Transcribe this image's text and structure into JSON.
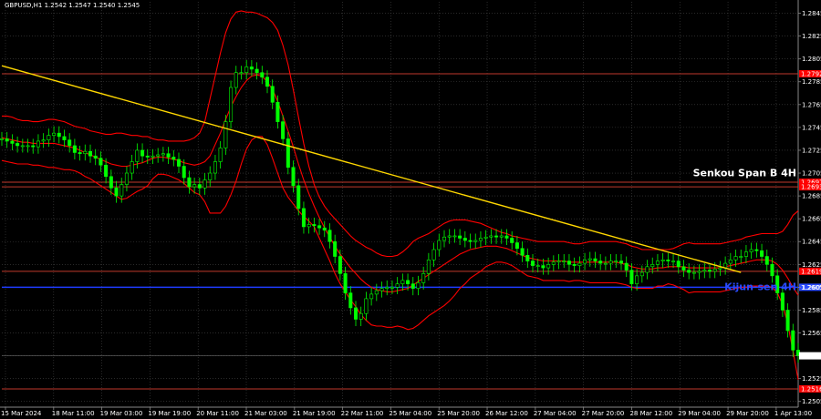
{
  "chart_data": {
    "type": "candlestick",
    "title": "GBPUSD,H1  1.2542 1.2547 1.2540 1.2545",
    "ylim": [
      1.25,
      1.2855
    ],
    "grid": true,
    "colors": {
      "background": "#000000",
      "candle_up": "#00ff00",
      "candle_down": "#00ff00",
      "ichimoku_lines": "#ff0000",
      "trendline": "#ffd700",
      "level_red": "#c0392b",
      "level_blue": "#1e3cff",
      "label_red": "#ff0000",
      "label_blue": "#2a4bff",
      "label_gray": "#777777"
    },
    "yticks": [
      "1.2845",
      "1.2825",
      "1.2805",
      "1.2785",
      "1.2765",
      "1.2745",
      "1.2725",
      "1.2705",
      "1.2685",
      "1.2665",
      "1.2645",
      "1.2625",
      "1.2605",
      "1.2585",
      "1.2565",
      "1.2545",
      "1.2525",
      "1.2505"
    ],
    "xticks": [
      "15 Mar 2024",
      "18 Mar 11:00",
      "19 Mar 03:00",
      "19 Mar 19:00",
      "20 Mar 11:00",
      "21 Mar 03:00",
      "21 Mar 19:00",
      "22 Mar 11:00",
      "25 Mar 04:00",
      "25 Mar 20:00",
      "26 Mar 12:00",
      "27 Mar 04:00",
      "27 Mar 20:00",
      "28 Mar 12:00",
      "29 Mar 04:00",
      "29 Mar 20:00",
      "1 Apr 13:00"
    ],
    "levels": [
      {
        "value": 1.2792,
        "label": "1.2792",
        "color": "#c0392b"
      },
      {
        "value": 1.2697,
        "label": "1.2697",
        "color": "#c0392b"
      },
      {
        "value": 1.2693,
        "label": "1.2693",
        "color": "#c0392b"
      },
      {
        "value": 1.2619,
        "label": "1.2619",
        "color": "#c0392b"
      },
      {
        "value": 1.2605,
        "label": "1.2605",
        "color": "#1e3cff"
      },
      {
        "value": 1.2516,
        "label": "1.2516",
        "color": "#c0392b"
      }
    ],
    "current_price": {
      "value": 1.2545,
      "label": "1.2545"
    },
    "annotations": [
      {
        "text": "Senkou Span B 4H",
        "price": 1.27,
        "color": "#ffffff"
      },
      {
        "text": "Kijun-sen 4H",
        "price": 1.26,
        "color": "#2a4bff"
      }
    ],
    "trendline": {
      "start": [
        0,
        1.2799
      ],
      "end": [
        142,
        1.2618
      ]
    },
    "close_series": [
      1.2735,
      1.2733,
      1.2731,
      1.2729,
      1.2729,
      1.2729,
      1.2728,
      1.2733,
      1.2734,
      1.2738,
      1.274,
      1.2737,
      1.2734,
      1.2729,
      1.2723,
      1.2722,
      1.2724,
      1.272,
      1.2718,
      1.2712,
      1.2702,
      1.2692,
      1.2685,
      1.2695,
      1.2705,
      1.2715,
      1.2725,
      1.272,
      1.2719,
      1.272,
      1.2721,
      1.2722,
      1.2719,
      1.2717,
      1.2711,
      1.2701,
      1.2693,
      1.2695,
      1.2692,
      1.2699,
      1.2705,
      1.2715,
      1.2727,
      1.275,
      1.278,
      1.2793,
      1.2793,
      1.2798,
      1.2796,
      1.2793,
      1.2789,
      1.2781,
      1.2767,
      1.275,
      1.2735,
      1.271,
      1.2694,
      1.2674,
      1.2658,
      1.266,
      1.2659,
      1.2657,
      1.2655,
      1.2645,
      1.2632,
      1.2617,
      1.26,
      1.2587,
      1.2577,
      1.2582,
      1.2595,
      1.2599,
      1.2602,
      1.2604,
      1.2605,
      1.2605,
      1.2608,
      1.2611,
      1.2608,
      1.2604,
      1.2609,
      1.2617,
      1.2629,
      1.2638,
      1.2646,
      1.2649,
      1.265,
      1.265,
      1.2648,
      1.2646,
      1.2645,
      1.2646,
      1.2648,
      1.2649,
      1.265,
      1.2649,
      1.265,
      1.2648,
      1.2644,
      1.2639,
      1.2633,
      1.2628,
      1.2624,
      1.2624,
      1.2622,
      1.2625,
      1.2627,
      1.2628,
      1.2628,
      1.2625,
      1.2624,
      1.2626,
      1.2629,
      1.263,
      1.2628,
      1.2626,
      1.2626,
      1.2628,
      1.2628,
      1.2626,
      1.262,
      1.2608,
      1.2615,
      1.2618,
      1.2623,
      1.2625,
      1.2628,
      1.2629,
      1.2628,
      1.2628,
      1.2623,
      1.262,
      1.2618,
      1.2618,
      1.2619,
      1.262,
      1.2619,
      1.2621,
      1.2622,
      1.2626,
      1.2629,
      1.2632,
      1.2632,
      1.2636,
      1.2638,
      1.2637,
      1.2632,
      1.2625,
      1.2615,
      1.26,
      1.2585,
      1.2567,
      1.255,
      1.2545
    ],
    "bollinger_upper": [
      1.2755,
      1.2755,
      1.2754,
      1.2752,
      1.2751,
      1.2751,
      1.275,
      1.275,
      1.2751,
      1.2752,
      1.2752,
      1.2751,
      1.275,
      1.2748,
      1.2746,
      1.2745,
      1.2744,
      1.2742,
      1.2741,
      1.274,
      1.2739,
      1.2739,
      1.274,
      1.274,
      1.2739,
      1.2738,
      1.2738,
      1.2737,
      1.2737,
      1.2735,
      1.2734,
      1.2734,
      1.2733,
      1.2733,
      1.2733,
      1.2733,
      1.2734,
      1.2736,
      1.274,
      1.275,
      1.277,
      1.279,
      1.281,
      1.2828,
      1.284,
      1.2846,
      1.2847,
      1.2846,
      1.2846,
      1.2845,
      1.2843,
      1.2841,
      1.2837,
      1.283,
      1.2817,
      1.28,
      1.2778,
      1.2754,
      1.2731,
      1.2711,
      1.2695,
      1.2684,
      1.2676,
      1.267,
      1.2665,
      1.266,
      1.2655,
      1.265,
      1.2646,
      1.2643,
      1.264,
      1.2638,
      1.2635,
      1.2633,
      1.2632,
      1.2632,
      1.2633,
      1.2636,
      1.264,
      1.2645,
      1.2648,
      1.265,
      1.2652,
      1.2655,
      1.2658,
      1.2661,
      1.2663,
      1.2664,
      1.2664,
      1.2664,
      1.2663,
      1.2662,
      1.2661,
      1.2659,
      1.2657,
      1.2655,
      1.2653,
      1.2652,
      1.265,
      1.2649,
      1.2648,
      1.2647,
      1.2646,
      1.2645,
      1.2645,
      1.2645,
      1.2645,
      1.2645,
      1.2645,
      1.2644,
      1.2643,
      1.2643,
      1.2644,
      1.2645,
      1.2645,
      1.2645,
      1.2645,
      1.2645,
      1.2645,
      1.2644,
      1.2643,
      1.2641,
      1.264,
      1.2638,
      1.2638,
      1.2638,
      1.2638,
      1.2638,
      1.2638,
      1.2639,
      1.2641,
      1.2643,
      1.2644,
      1.2643,
      1.2643,
      1.2643,
      1.2643,
      1.2643,
      1.2643,
      1.2644,
      1.2645,
      1.2646,
      1.2647,
      1.2649,
      1.265,
      1.2651,
      1.2652,
      1.2652,
      1.2652,
      1.2652,
      1.2654,
      1.266,
      1.2668,
      1.2672
    ],
    "bollinger_middle": [
      1.2736,
      1.2735,
      1.2734,
      1.2733,
      1.2732,
      1.2732,
      1.2731,
      1.2731,
      1.2731,
      1.2731,
      1.2731,
      1.273,
      1.2729,
      1.2728,
      1.2727,
      1.2725,
      1.2723,
      1.2721,
      1.2719,
      1.2717,
      1.2715,
      1.2713,
      1.2712,
      1.2711,
      1.2711,
      1.2712,
      1.2713,
      1.2714,
      1.2716,
      1.2718,
      1.2719,
      1.2719,
      1.2718,
      1.2717,
      1.2716,
      1.2714,
      1.2713,
      1.2712,
      1.2713,
      1.2715,
      1.272,
      1.273,
      1.274,
      1.2752,
      1.2763,
      1.2772,
      1.278,
      1.2786,
      1.279,
      1.2791,
      1.279,
      1.2785,
      1.2778,
      1.2768,
      1.2755,
      1.2742,
      1.2728,
      1.2713,
      1.2699,
      1.2687,
      1.2676,
      1.2666,
      1.2657,
      1.2649,
      1.2641,
      1.2634,
      1.2628,
      1.2622,
      1.2617,
      1.2612,
      1.2608,
      1.2605,
      1.2603,
      1.2602,
      1.2601,
      1.2601,
      1.2602,
      1.2603,
      1.2604,
      1.2607,
      1.261,
      1.2613,
      1.2616,
      1.2619,
      1.2622,
      1.2625,
      1.2628,
      1.2631,
      1.2634,
      1.2636,
      1.2638,
      1.2639,
      1.264,
      1.2641,
      1.2641,
      1.2641,
      1.264,
      1.2639,
      1.2637,
      1.2635,
      1.2633,
      1.2631,
      1.263,
      1.2629,
      1.2628,
      1.2628,
      1.2628,
      1.2628,
      1.2628,
      1.2627,
      1.2627,
      1.2627,
      1.2627,
      1.2627,
      1.2627,
      1.2627,
      1.2627,
      1.2627,
      1.2627,
      1.2626,
      1.2625,
      1.2623,
      1.2622,
      1.2621,
      1.2621,
      1.2621,
      1.2622,
      1.2622,
      1.2623,
      1.2623,
      1.2623,
      1.2623,
      1.2622,
      1.2622,
      1.2622,
      1.2622,
      1.2622,
      1.2622,
      1.2622,
      1.2623,
      1.2624,
      1.2625,
      1.2626,
      1.2627,
      1.2628,
      1.2629,
      1.2629,
      1.2629,
      1.2628,
      1.2625,
      1.262,
      1.2613,
      1.2605,
      1.2598
    ],
    "bollinger_lower": [
      1.2716,
      1.2715,
      1.2714,
      1.2713,
      1.2713,
      1.2713,
      1.2712,
      1.2712,
      1.2711,
      1.271,
      1.271,
      1.2709,
      1.2708,
      1.2708,
      1.2707,
      1.2705,
      1.2702,
      1.27,
      1.2697,
      1.2694,
      1.2691,
      1.2688,
      1.2685,
      1.2682,
      1.2683,
      1.2686,
      1.2689,
      1.2691,
      1.2694,
      1.27,
      1.2704,
      1.2704,
      1.2703,
      1.2701,
      1.2699,
      1.2696,
      1.2692,
      1.2688,
      1.2686,
      1.268,
      1.267,
      1.267,
      1.267,
      1.2676,
      1.2686,
      1.2698,
      1.2713,
      1.2726,
      1.2734,
      1.2737,
      1.2737,
      1.273,
      1.2718,
      1.2705,
      1.2692,
      1.2684,
      1.2678,
      1.2672,
      1.2667,
      1.2663,
      1.2658,
      1.2648,
      1.2638,
      1.2628,
      1.2617,
      1.2608,
      1.2601,
      1.2594,
      1.2588,
      1.2581,
      1.2576,
      1.2572,
      1.2571,
      1.2571,
      1.257,
      1.257,
      1.2571,
      1.257,
      1.2568,
      1.2569,
      1.2572,
      1.2576,
      1.258,
      1.2583,
      1.2586,
      1.2589,
      1.2593,
      1.2598,
      1.2604,
      1.2608,
      1.2613,
      1.2616,
      1.2619,
      1.2623,
      1.2625,
      1.2627,
      1.2627,
      1.2626,
      1.2624,
      1.2621,
      1.2618,
      1.2615,
      1.2614,
      1.2613,
      1.2611,
      1.2611,
      1.2611,
      1.2611,
      1.2611,
      1.261,
      1.2611,
      1.2611,
      1.261,
      1.2609,
      1.2609,
      1.2609,
      1.2609,
      1.2609,
      1.2609,
      1.2608,
      1.2607,
      1.2605,
      1.2604,
      1.2604,
      1.2604,
      1.2604,
      1.2606,
      1.2606,
      1.2608,
      1.2607,
      1.2605,
      1.2603,
      1.26,
      1.2601,
      1.2601,
      1.2601,
      1.2601,
      1.2601,
      1.2601,
      1.2602,
      1.2603,
      1.2604,
      1.2605,
      1.2605,
      1.2606,
      1.2606,
      1.2606,
      1.2606,
      1.2605,
      1.26,
      1.259,
      1.2573,
      1.2549,
      1.2524
    ]
  }
}
